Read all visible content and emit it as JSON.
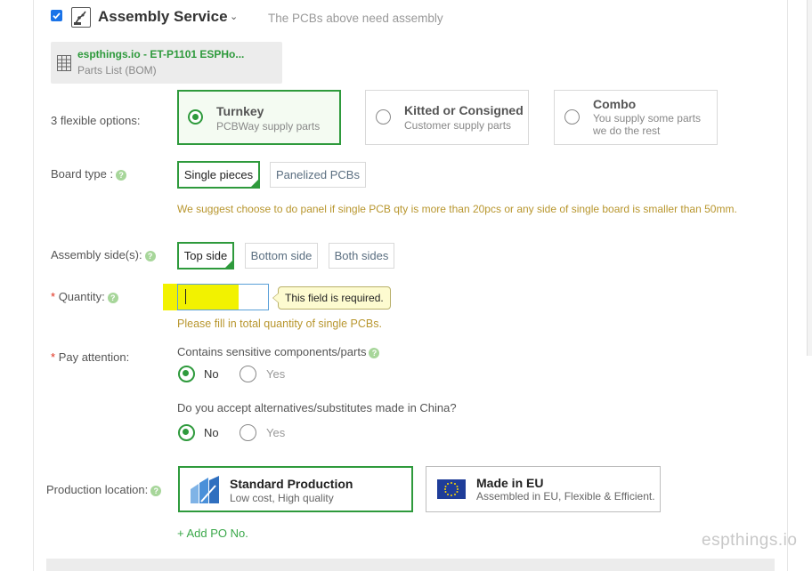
{
  "header": {
    "checkbox_checked": true,
    "title": "Assembly Service",
    "caret": "⌄",
    "subtitle": "The PCBs above need assembly"
  },
  "bom": {
    "name": "espthings.io - ET-P1101 ESPHo...",
    "type": "Parts List (BOM)"
  },
  "options": {
    "label": "3 flexible options:",
    "cards": [
      {
        "title": "Turnkey",
        "sub1": "PCBWay supply parts",
        "sub2": "",
        "selected": true
      },
      {
        "title": "Kitted or Consigned",
        "sub1": "Customer supply parts",
        "sub2": "",
        "selected": false
      },
      {
        "title": "Combo",
        "sub1": "You supply some parts",
        "sub2": "we do the rest",
        "selected": false
      }
    ]
  },
  "board_type": {
    "label": "Board type :",
    "buttons": [
      "Single pieces",
      "Panelized PCBs"
    ],
    "selected": "Single pieces",
    "warning": "We suggest choose to do panel if single PCB qty is more than 20pcs or any side of single board is smaller than 50mm."
  },
  "assembly_side": {
    "label": "Assembly side(s):",
    "buttons": [
      "Top side",
      "Bottom side",
      "Both sides"
    ],
    "selected": "Top side"
  },
  "quantity": {
    "star": "*",
    "label": "Quantity:",
    "value": "",
    "tooltip": "This field is required.",
    "hint": "Please fill in total quantity of single PCBs."
  },
  "pay_attention": {
    "star": "*",
    "label": "Pay attention:",
    "q1": "Contains sensitive components/parts",
    "q1_options": [
      "No",
      "Yes"
    ],
    "q1_selected": "No",
    "q2": "Do you accept alternatives/substitutes made in China?",
    "q2_options": [
      "No",
      "Yes"
    ],
    "q2_selected": "No"
  },
  "production": {
    "label": "Production location:",
    "cards": [
      {
        "title": "Standard Production",
        "sub": "Low cost, High quality",
        "selected": true
      },
      {
        "title": "Made in EU",
        "sub": "Assembled in EU, Flexible & Efficient.",
        "selected": false
      }
    ],
    "add_po": "+ Add PO No."
  },
  "help_glyph": "?",
  "watermark": "espthings.io",
  "colors": {
    "accent_green": "#2e9a3c",
    "warning": "#b8962e",
    "required": "#e0301e",
    "highlight": "#f2f200"
  }
}
